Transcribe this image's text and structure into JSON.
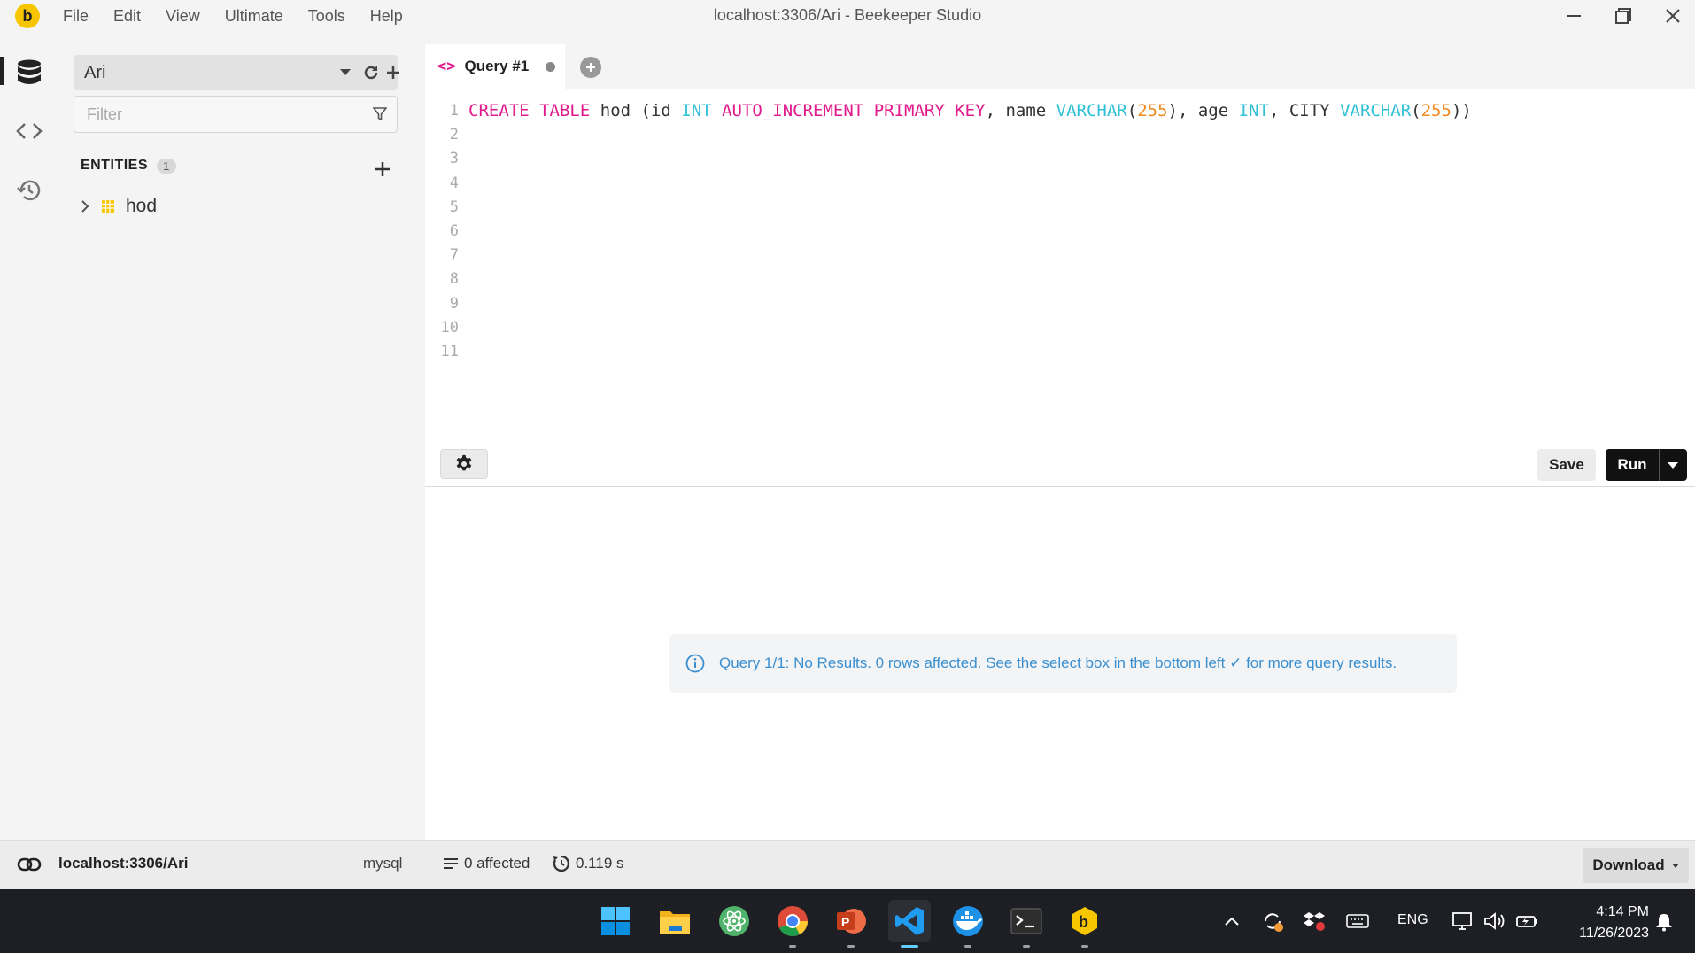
{
  "window": {
    "title": "localhost:3306/Ari - Beekeeper Studio",
    "logo_letter": "b"
  },
  "menu": [
    "File",
    "Edit",
    "View",
    "Ultimate",
    "Tools",
    "Help"
  ],
  "sidebar": {
    "connection": "Ari",
    "filter_placeholder": "Filter",
    "entities_label": "ENTITIES",
    "entities_count": "1",
    "entities": [
      {
        "name": "hod",
        "icon": "table-icon"
      }
    ]
  },
  "tabs": [
    {
      "title": "Query #1",
      "icon": "code-icon",
      "unsaved": true
    }
  ],
  "editor": {
    "line_numbers": [
      "1",
      "2",
      "3",
      "4",
      "5",
      "6",
      "7",
      "8",
      "9",
      "10",
      "11"
    ],
    "code": "CREATE TABLE hod (id INT AUTO_INCREMENT PRIMARY KEY, name VARCHAR(255), age INT, CITY VARCHAR(255))",
    "syntax_colors": {
      "keyword": "#e0198c",
      "type": "#2fc0d6",
      "number": "#f28a1e",
      "identifier": "#333333"
    }
  },
  "toolbar": {
    "save_label": "Save",
    "run_label": "Run"
  },
  "result": {
    "message": "Query 1/1: No Results. 0 rows affected. See the select box in the bottom left ✓ for more query results.",
    "color": "#3a8fd1"
  },
  "statusbar": {
    "host": "localhost:3306/Ari",
    "db_type": "mysql",
    "affected": "0 affected",
    "time": "0.119 s",
    "download_label": "Download"
  },
  "taskbar": {
    "apps": [
      "windows-start-icon",
      "file-explorer-icon",
      "atom-icon",
      "chrome-icon",
      "powerpoint-icon",
      "vscode-icon",
      "docker-icon",
      "terminal-icon",
      "beekeeper-icon"
    ],
    "lang": "ENG",
    "time": "4:14 PM",
    "date": "11/26/2023"
  }
}
